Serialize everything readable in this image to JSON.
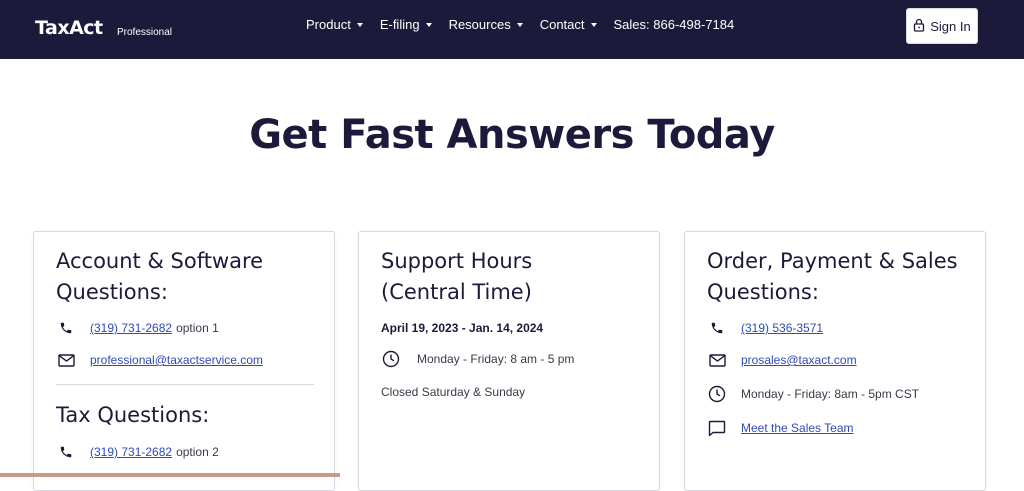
{
  "header": {
    "logo": "TaxAct",
    "logo_sub": "Professional",
    "nav": [
      {
        "label": "Product"
      },
      {
        "label": "E-filing"
      },
      {
        "label": "Resources"
      },
      {
        "label": "Contact"
      }
    ],
    "sales": "Sales: 866-498-7184",
    "sign_in": "Sign In"
  },
  "hero": {
    "title": "Get Fast Answers Today"
  },
  "card_account": {
    "title_line1": "Account & Software",
    "title_line2": "Questions:",
    "phone": "(319) 731-2682",
    "phone_suffix": "option 1",
    "email": "professional@taxactservice.com",
    "tax_title": "Tax Questions:",
    "tax_phone": "(319) 731-2682",
    "tax_phone_suffix": "option 2"
  },
  "card_support": {
    "title_line1": "Support Hours",
    "title_line2": "(Central Time)",
    "date_range": "April 19, 2023 - Jan. 14, 2024",
    "hours": "Monday - Friday: 8 am - 5 pm",
    "closed": "Closed Saturday & Sunday"
  },
  "card_sales": {
    "title_line1": "Order, Payment & Sales",
    "title_line2": "Questions:",
    "phone": "(319) 536-3571",
    "email": "prosales@taxact.com",
    "hours": "Monday - Friday: 8am - 5pm CST",
    "team_link": "Meet the Sales Team"
  },
  "icons": {
    "phone": "phone-icon",
    "mail": "mail-icon",
    "clock": "clock-icon",
    "chat": "chat-icon",
    "lock": "lock-icon"
  },
  "colors": {
    "brand_dark": "#1c1a3a",
    "link": "#2f4bb5"
  }
}
